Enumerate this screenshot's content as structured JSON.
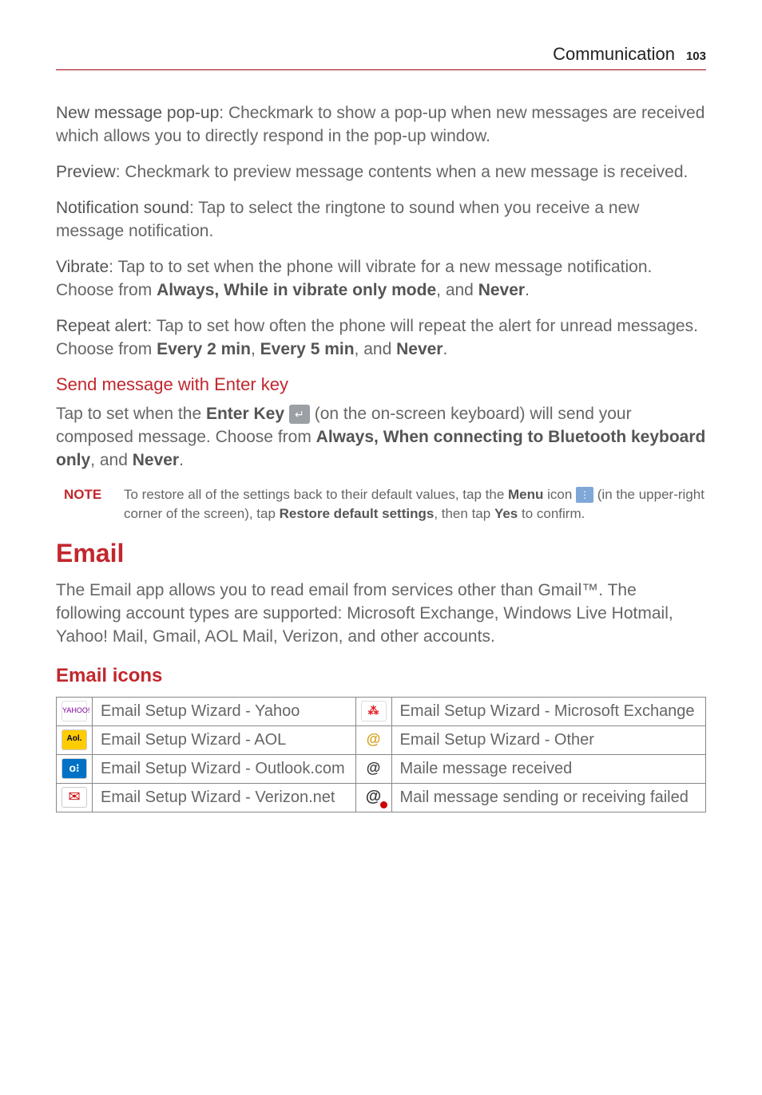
{
  "header": {
    "title": "Communication",
    "page": "103"
  },
  "p1": {
    "lead": "New message pop-up",
    "rest": ": Checkmark to show a pop-up when new messages are received which allows you to directly respond in the pop-up window."
  },
  "p2": {
    "lead": "Preview",
    "rest": ": Checkmark to preview message contents when a new message is received."
  },
  "p3": {
    "lead": "Notification sound",
    "rest": ": Tap to select the ringtone to sound when you receive a new message notification."
  },
  "p4": {
    "lead": "Vibrate",
    "mid1": ": Tap to to set when the phone will vibrate for a new message notification. Choose from ",
    "b1": "Always, While in vibrate only mode",
    "mid2": ", and ",
    "b2": "Never",
    "end": "."
  },
  "p5": {
    "lead": "Repeat alert",
    "mid1": ": Tap to set how often the phone will repeat the alert for unread messages. Choose from ",
    "b1": "Every 2 min",
    "c1": ", ",
    "b2": "Every 5 min",
    "c2": ", and ",
    "b3": "Never",
    "end": "."
  },
  "sub1": "Send message with Enter key",
  "p6": {
    "a": "Tap to set when the ",
    "b1": "Enter Key",
    "b": " (on the on-screen keyboard) will send your composed message. Choose from ",
    "b2": "Always, When connecting to Bluetooth keyboard only",
    "c": ", and ",
    "b3": "Never",
    "end": "."
  },
  "note": {
    "label": "NOTE",
    "a": "To restore all of the settings back to their default values, tap the ",
    "b1": "Menu",
    "b": " icon ",
    "c": " (in the upper-right corner of the screen), tap ",
    "b2": "Restore default settings",
    "d": ", then tap ",
    "b3": "Yes",
    "e": " to confirm."
  },
  "h1": "Email",
  "p7": "The Email app allows you to read email from services other than Gmail™. The following account types are supported: Microsoft Exchange, Windows Live Hotmail, Yahoo! Mail, Gmail, AOL Mail, Verizon, and other accounts.",
  "h2": "Email icons",
  "table": {
    "r1c1": "Email Setup Wizard - Yahoo",
    "r1c2": "Email Setup Wizard - Microsoft Exchange",
    "r2c1": "Email Setup Wizard - AOL",
    "r2c2": "Email Setup Wizard - Other",
    "r3c1": "Email Setup Wizard - Outlook.com",
    "r3c2": "Maile message received",
    "r4c1": "Email Setup Wizard - Verizon.net",
    "r4c2": "Mail message sending or receiving failed"
  },
  "icons": {
    "yahoo": "YAHOO!",
    "aol": "Aol.",
    "outlook": "o⁝",
    "verizon": "✉",
    "msx": "⁂",
    "other": "@",
    "recv": "@",
    "fail": "@"
  },
  "glyph": {
    "enter": "↵",
    "menu": "⋮"
  }
}
